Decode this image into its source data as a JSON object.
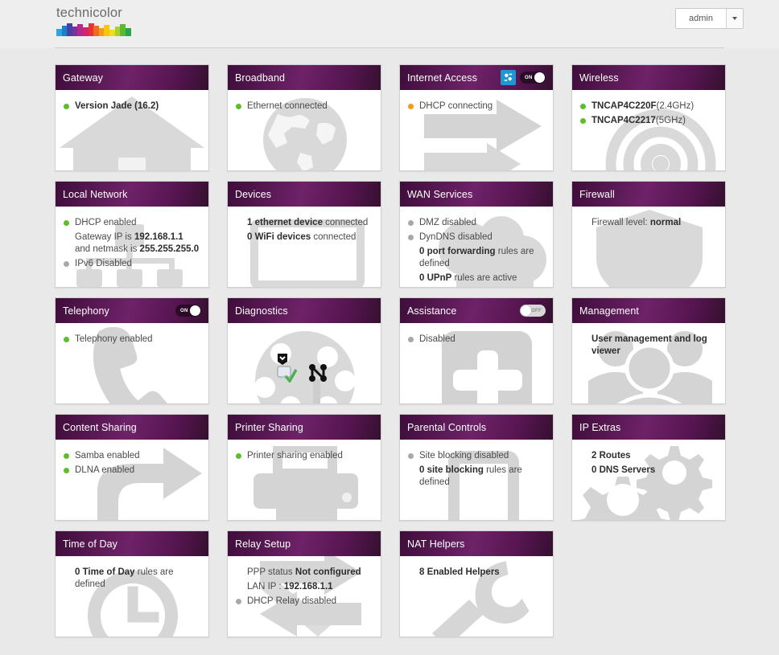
{
  "header": {
    "brand": "technicolor",
    "logo_icon": "technicolor-spectrum-logo",
    "user": "admin",
    "caret_icon": "chevron-down-icon",
    "logo_colors": [
      "#2ea3dd",
      "#1f7fc4",
      "#4a3fa5",
      "#7a32a0",
      "#b32a8f",
      "#d6246a",
      "#e5333a",
      "#ef6b22",
      "#f59b16",
      "#f7c70f",
      "#e8e119",
      "#aacf2b",
      "#5bb933",
      "#2aa44a"
    ]
  },
  "cards": [
    {
      "id": "gateway",
      "title": "Gateway",
      "watermark": "house-icon",
      "lines": [
        {
          "dot": "green",
          "parts": [
            {
              "t": "Version Jade (16.2)",
              "bold": true
            }
          ]
        }
      ]
    },
    {
      "id": "broadband",
      "title": "Broadband",
      "watermark": "globe-icon",
      "lines": [
        {
          "dot": "green",
          "parts": [
            {
              "t": "Ethernet connected",
              "bold": false
            }
          ]
        }
      ]
    },
    {
      "id": "internet-access",
      "title": "Internet Access",
      "watermark": "arrow-right-icon",
      "gear": true,
      "toggle": {
        "state": "on",
        "label": "ON"
      },
      "lines": [
        {
          "dot": "orange",
          "parts": [
            {
              "t": "DHCP connecting",
              "bold": false
            }
          ]
        }
      ]
    },
    {
      "id": "wireless",
      "title": "Wireless",
      "watermark": "wifi-rings-icon",
      "lines": [
        {
          "dot": "green",
          "parts": [
            {
              "t": "TNCAP4C220F",
              "bold": true
            },
            {
              "t": "(2.4GHz)",
              "bold": false
            }
          ]
        },
        {
          "dot": "green",
          "parts": [
            {
              "t": "TNCAP4C2217",
              "bold": true
            },
            {
              "t": "(5GHz)",
              "bold": false
            }
          ]
        }
      ]
    },
    {
      "id": "local-network",
      "title": "Local Network",
      "watermark": "network-tree-icon",
      "lines": [
        {
          "dot": "green",
          "parts": [
            {
              "t": "DHCP enabled",
              "bold": false
            }
          ]
        },
        {
          "dot": "none",
          "parts": [
            {
              "t": "Gateway IP is ",
              "bold": false
            },
            {
              "t": "192.168.1.1",
              "bold": true
            },
            {
              "t": " and netmask is ",
              "bold": false
            },
            {
              "t": "255.255.255.0",
              "bold": true
            }
          ]
        },
        {
          "dot": "grey",
          "parts": [
            {
              "t": "IPv6 Disabled",
              "bold": false
            }
          ]
        }
      ]
    },
    {
      "id": "devices",
      "title": "Devices",
      "watermark": "laptop-icon",
      "lines": [
        {
          "dot": "none",
          "parts": [
            {
              "t": "1 ethernet device",
              "bold": true
            },
            {
              "t": " connected",
              "bold": false
            }
          ]
        },
        {
          "dot": "none",
          "parts": [
            {
              "t": "0 WiFi devices",
              "bold": true
            },
            {
              "t": " connected",
              "bold": false
            }
          ]
        }
      ]
    },
    {
      "id": "wan-services",
      "title": "WAN Services",
      "watermark": "cloud-icon",
      "lines": [
        {
          "dot": "grey",
          "parts": [
            {
              "t": "DMZ disabled",
              "bold": false
            }
          ]
        },
        {
          "dot": "grey",
          "parts": [
            {
              "t": "DynDNS disabled",
              "bold": false
            }
          ]
        },
        {
          "dot": "none",
          "parts": [
            {
              "t": "0 port forwarding",
              "bold": true
            },
            {
              "t": " rules are defined",
              "bold": false
            }
          ]
        },
        {
          "dot": "none",
          "parts": [
            {
              "t": "0 UPnP",
              "bold": true
            },
            {
              "t": " rules are active",
              "bold": false
            }
          ]
        }
      ]
    },
    {
      "id": "firewall",
      "title": "Firewall",
      "watermark": "shield-icon",
      "lines": [
        {
          "dot": "none",
          "parts": [
            {
              "t": "Firewall level: ",
              "bold": false
            },
            {
              "t": "normal",
              "bold": true
            }
          ]
        }
      ]
    },
    {
      "id": "telephony",
      "title": "Telephony",
      "watermark": "phone-handset-icon",
      "toggle": {
        "state": "on",
        "label": "ON"
      },
      "lines": [
        {
          "dot": "green",
          "parts": [
            {
              "t": "Telephony enabled",
              "bold": false
            }
          ]
        }
      ]
    },
    {
      "id": "diagnostics",
      "title": "Diagnostics",
      "watermark": "info-circle-icon",
      "diag_icons": true,
      "lines": []
    },
    {
      "id": "assistance",
      "title": "Assistance",
      "watermark": "plus-square-icon",
      "toggle": {
        "state": "off",
        "label": "OFF"
      },
      "lines": [
        {
          "dot": "grey",
          "parts": [
            {
              "t": "Disabled",
              "bold": false
            }
          ]
        }
      ]
    },
    {
      "id": "management",
      "title": "Management",
      "watermark": "users-group-icon",
      "lines": [
        {
          "dot": "none",
          "parts": [
            {
              "t": "User management and log viewer",
              "bold": true
            }
          ]
        }
      ]
    },
    {
      "id": "content-sharing",
      "title": "Content Sharing",
      "watermark": "share-arrow-icon",
      "lines": [
        {
          "dot": "green",
          "parts": [
            {
              "t": "Samba enabled",
              "bold": false
            }
          ]
        },
        {
          "dot": "green",
          "parts": [
            {
              "t": "DLNA enabled",
              "bold": false
            }
          ]
        }
      ]
    },
    {
      "id": "printer-sharing",
      "title": "Printer Sharing",
      "watermark": "printer-icon",
      "lines": [
        {
          "dot": "green",
          "parts": [
            {
              "t": "Printer sharing enabled",
              "bold": false
            }
          ]
        }
      ]
    },
    {
      "id": "parental-controls",
      "title": "Parental Controls",
      "watermark": "mobile-phone-icon",
      "lines": [
        {
          "dot": "grey",
          "parts": [
            {
              "t": "Site blocking disabled",
              "bold": false
            }
          ]
        },
        {
          "dot": "none",
          "parts": [
            {
              "t": "0 site blocking",
              "bold": true
            },
            {
              "t": " rules are defined",
              "bold": false
            }
          ]
        }
      ]
    },
    {
      "id": "ip-extras",
      "title": "IP Extras",
      "watermark": "gears-icon",
      "lines": [
        {
          "dot": "none",
          "parts": [
            {
              "t": "2 Routes",
              "bold": true
            }
          ]
        },
        {
          "dot": "none",
          "parts": [
            {
              "t": "0 DNS Servers",
              "bold": true
            }
          ]
        }
      ]
    },
    {
      "id": "time-of-day",
      "title": "Time of Day",
      "watermark": "clock-icon",
      "lines": [
        {
          "dot": "none",
          "parts": [
            {
              "t": "0 Time of Day",
              "bold": true
            },
            {
              "t": " rules are defined",
              "bold": false
            }
          ]
        }
      ]
    },
    {
      "id": "relay-setup",
      "title": "Relay Setup",
      "watermark": "relay-arrows-icon",
      "lines": [
        {
          "dot": "none",
          "parts": [
            {
              "t": "PPP status ",
              "bold": false
            },
            {
              "t": "Not configured",
              "bold": true
            }
          ]
        },
        {
          "dot": "none",
          "parts": [
            {
              "t": "LAN IP : ",
              "bold": false
            },
            {
              "t": "192.168.1.1",
              "bold": true
            }
          ]
        },
        {
          "dot": "grey",
          "parts": [
            {
              "t": "DHCP Relay disabled",
              "bold": false
            }
          ]
        }
      ]
    },
    {
      "id": "nat-helpers",
      "title": "NAT Helpers",
      "watermark": "wrench-icon",
      "lines": [
        {
          "dot": "none",
          "parts": [
            {
              "t": "8 Enabled Helpers",
              "bold": true
            }
          ]
        }
      ]
    }
  ]
}
